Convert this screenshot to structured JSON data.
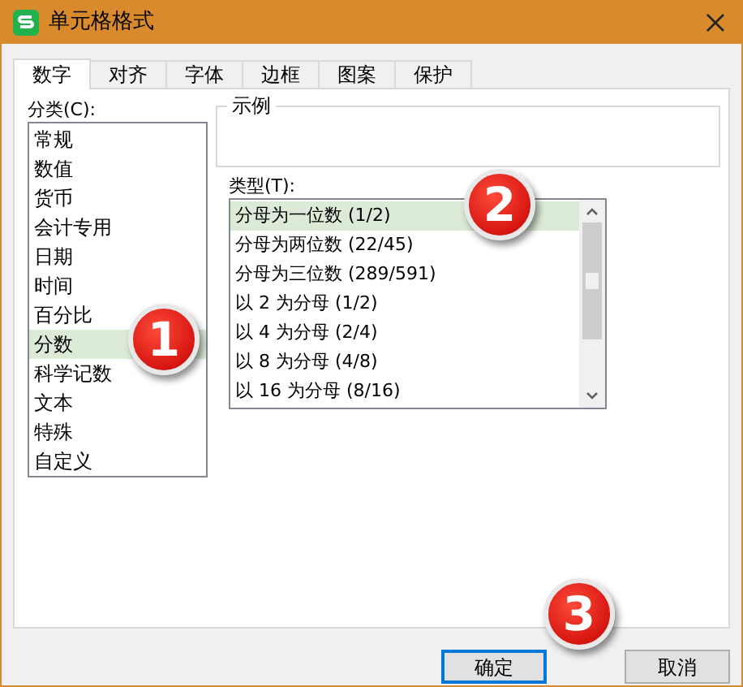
{
  "window": {
    "title": "单元格格式"
  },
  "tabs": [
    {
      "label": "数字",
      "selected": true
    },
    {
      "label": "对齐",
      "selected": false
    },
    {
      "label": "字体",
      "selected": false
    },
    {
      "label": "边框",
      "selected": false
    },
    {
      "label": "图案",
      "selected": false
    },
    {
      "label": "保护",
      "selected": false
    }
  ],
  "category": {
    "label": "分类(C):",
    "items": [
      {
        "label": "常规",
        "selected": false
      },
      {
        "label": "数值",
        "selected": false
      },
      {
        "label": "货币",
        "selected": false
      },
      {
        "label": "会计专用",
        "selected": false
      },
      {
        "label": "日期",
        "selected": false
      },
      {
        "label": "时间",
        "selected": false
      },
      {
        "label": "百分比",
        "selected": false
      },
      {
        "label": "分数",
        "selected": true
      },
      {
        "label": "科学记数",
        "selected": false
      },
      {
        "label": "文本",
        "selected": false
      },
      {
        "label": "特殊",
        "selected": false
      },
      {
        "label": "自定义",
        "selected": false
      }
    ]
  },
  "sample": {
    "label": "示例"
  },
  "type": {
    "label": "类型(T):",
    "items": [
      {
        "label": "分母为一位数 (1/2)",
        "selected": true
      },
      {
        "label": "分母为两位数 (22/45)",
        "selected": false
      },
      {
        "label": "分母为三位数 (289/591)",
        "selected": false
      },
      {
        "label": "以 2 为分母 (1/2)",
        "selected": false
      },
      {
        "label": "以 4 为分母 (2/4)",
        "selected": false
      },
      {
        "label": "以 8 为分母 (4/8)",
        "selected": false
      },
      {
        "label": "以 16 为分母 (8/16)",
        "selected": false
      }
    ]
  },
  "buttons": [
    "确定",
    "取消"
  ],
  "callouts": [
    "1",
    "2",
    "3"
  ]
}
